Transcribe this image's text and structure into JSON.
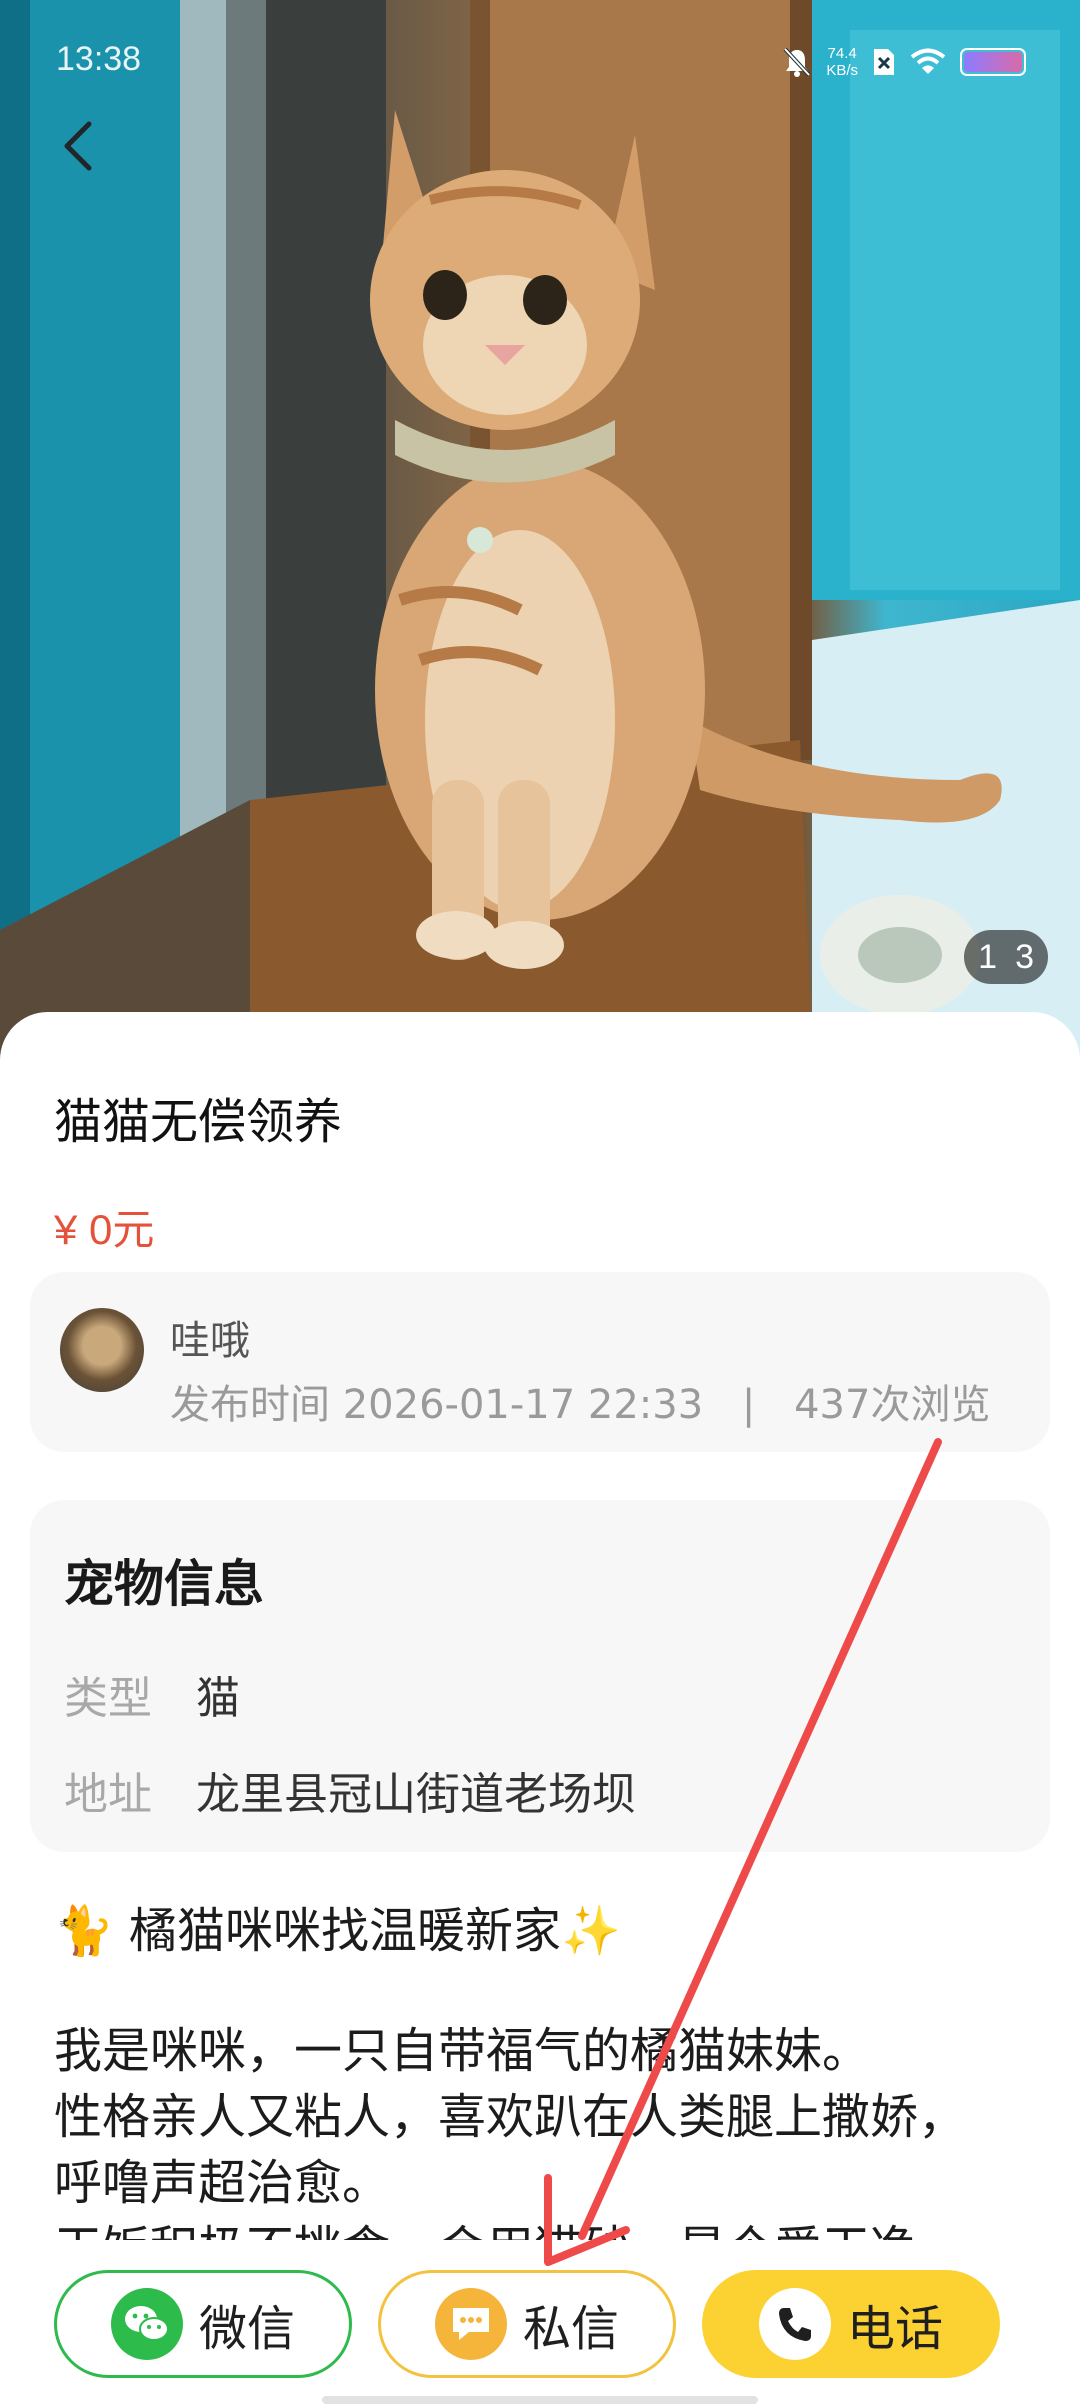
{
  "status_bar": {
    "time": "13:38",
    "net_speed_value": "74.4",
    "net_speed_unit": "KB/s",
    "icons": [
      "bell-muted-icon",
      "sim-off-icon",
      "wifi-icon",
      "battery-icon"
    ]
  },
  "hero": {
    "image_counter": {
      "current": "1",
      "total": "3"
    }
  },
  "post": {
    "title": "猫猫无偿领养",
    "price": "¥ 0元"
  },
  "author": {
    "name": "哇哦",
    "published_label": "发布时间",
    "published_at": "2026-01-17 22:33",
    "separator": "|",
    "views": "437次浏览"
  },
  "pet_info": {
    "heading": "宠物信息",
    "rows": [
      {
        "key": "类型",
        "value": "猫"
      },
      {
        "key": "地址",
        "value": "龙里县冠山街道老场坝"
      }
    ]
  },
  "description": {
    "headline": "🐈 橘猫咪咪找温暖新家✨",
    "lines": [
      "我是咪咪，一只自带福气的橘猫妹妹。",
      "性格亲人又粘人，喜欢趴在人类腿上撒娇，",
      "呼噜声超治愈。",
      "干饭积极不挑食，会用猫砂，是个爱干净"
    ]
  },
  "actions": {
    "wechat_label": "微信",
    "message_label": "私信",
    "call_label": "电话"
  },
  "colors": {
    "price": "#e5523c",
    "wechat_green": "#2eba4c",
    "message_orange": "#f4b53a",
    "call_yellow": "#fcd233",
    "annotation_arrow": "#ef4a4a"
  }
}
